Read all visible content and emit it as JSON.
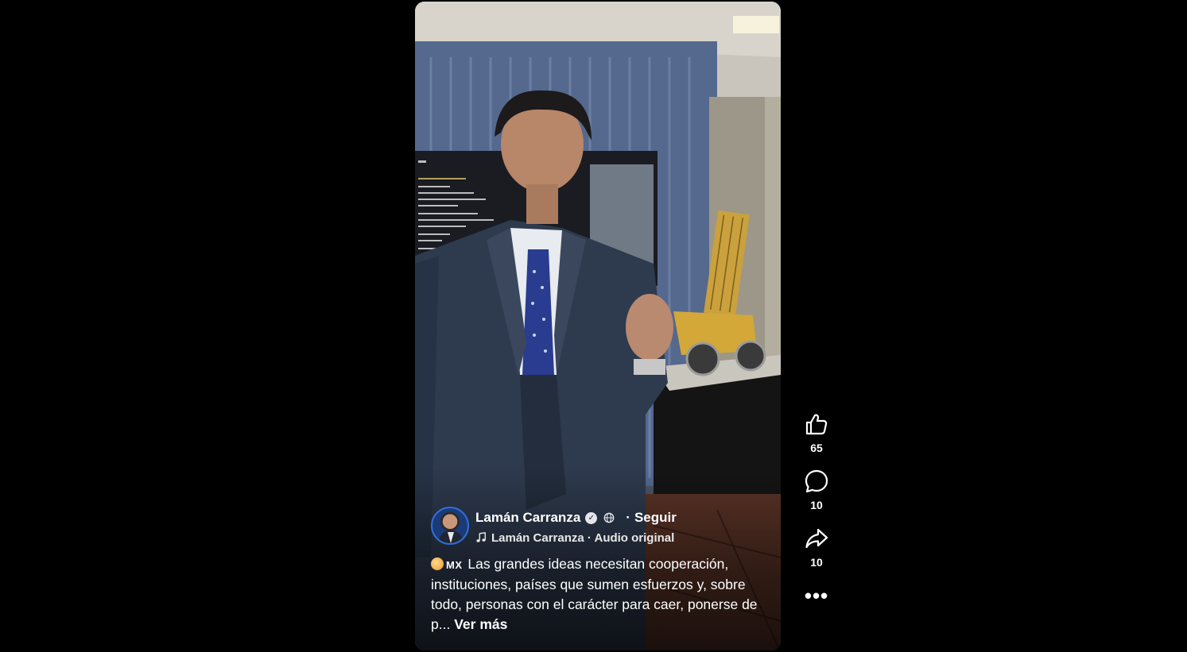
{
  "post": {
    "author_name": "Lamán Carranza",
    "follow_label": "Seguir",
    "separator": "·",
    "audio_label": "Lamán Carranza · Audio original",
    "caption": {
      "country_code": "MX",
      "text": "Las grandes ideas necesitan cooperación, instituciones, países que sumen esfuerzos y, sobre todo, personas con el carácter para caer, ponerse de p...",
      "see_more": "Ver más"
    }
  },
  "actions": {
    "likes": "65",
    "comments": "10",
    "shares": "10",
    "more_label": "•••"
  },
  "icons": {
    "like": "thumbs-up-icon",
    "comment": "comment-bubble-icon",
    "share": "share-arrow-icon",
    "verified": "verified-badge-icon",
    "privacy": "globe-icon",
    "audio": "music-note-icon"
  },
  "colors": {
    "background": "#000000",
    "text": "#ffffff",
    "avatar_ring": "#2f6fd8"
  }
}
